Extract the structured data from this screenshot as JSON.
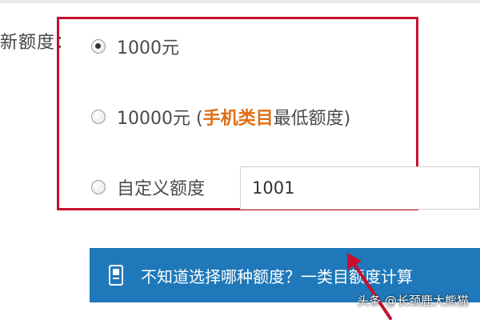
{
  "form": {
    "field_label": "新额度：",
    "options": [
      {
        "label": "1000元",
        "selected": true
      },
      {
        "label_prefix": "10000元 (",
        "label_accent": "手机类目",
        "label_suffix": "最低额度)",
        "selected": false,
        "accent_color": "#e06d14"
      },
      {
        "label": "自定义额度",
        "selected": false
      }
    ],
    "custom_amount": {
      "value": "1001"
    }
  },
  "info_banner": {
    "icon": "calculator-icon",
    "text": "不知道选择哪种额度？一类目额度计算",
    "background_color": "#1f78b9"
  },
  "annotation": {
    "highlight_color": "#c8102e",
    "arrow_color": "#c8102e"
  },
  "watermark": {
    "text": "头条 @长颈鹿大熊猫"
  }
}
